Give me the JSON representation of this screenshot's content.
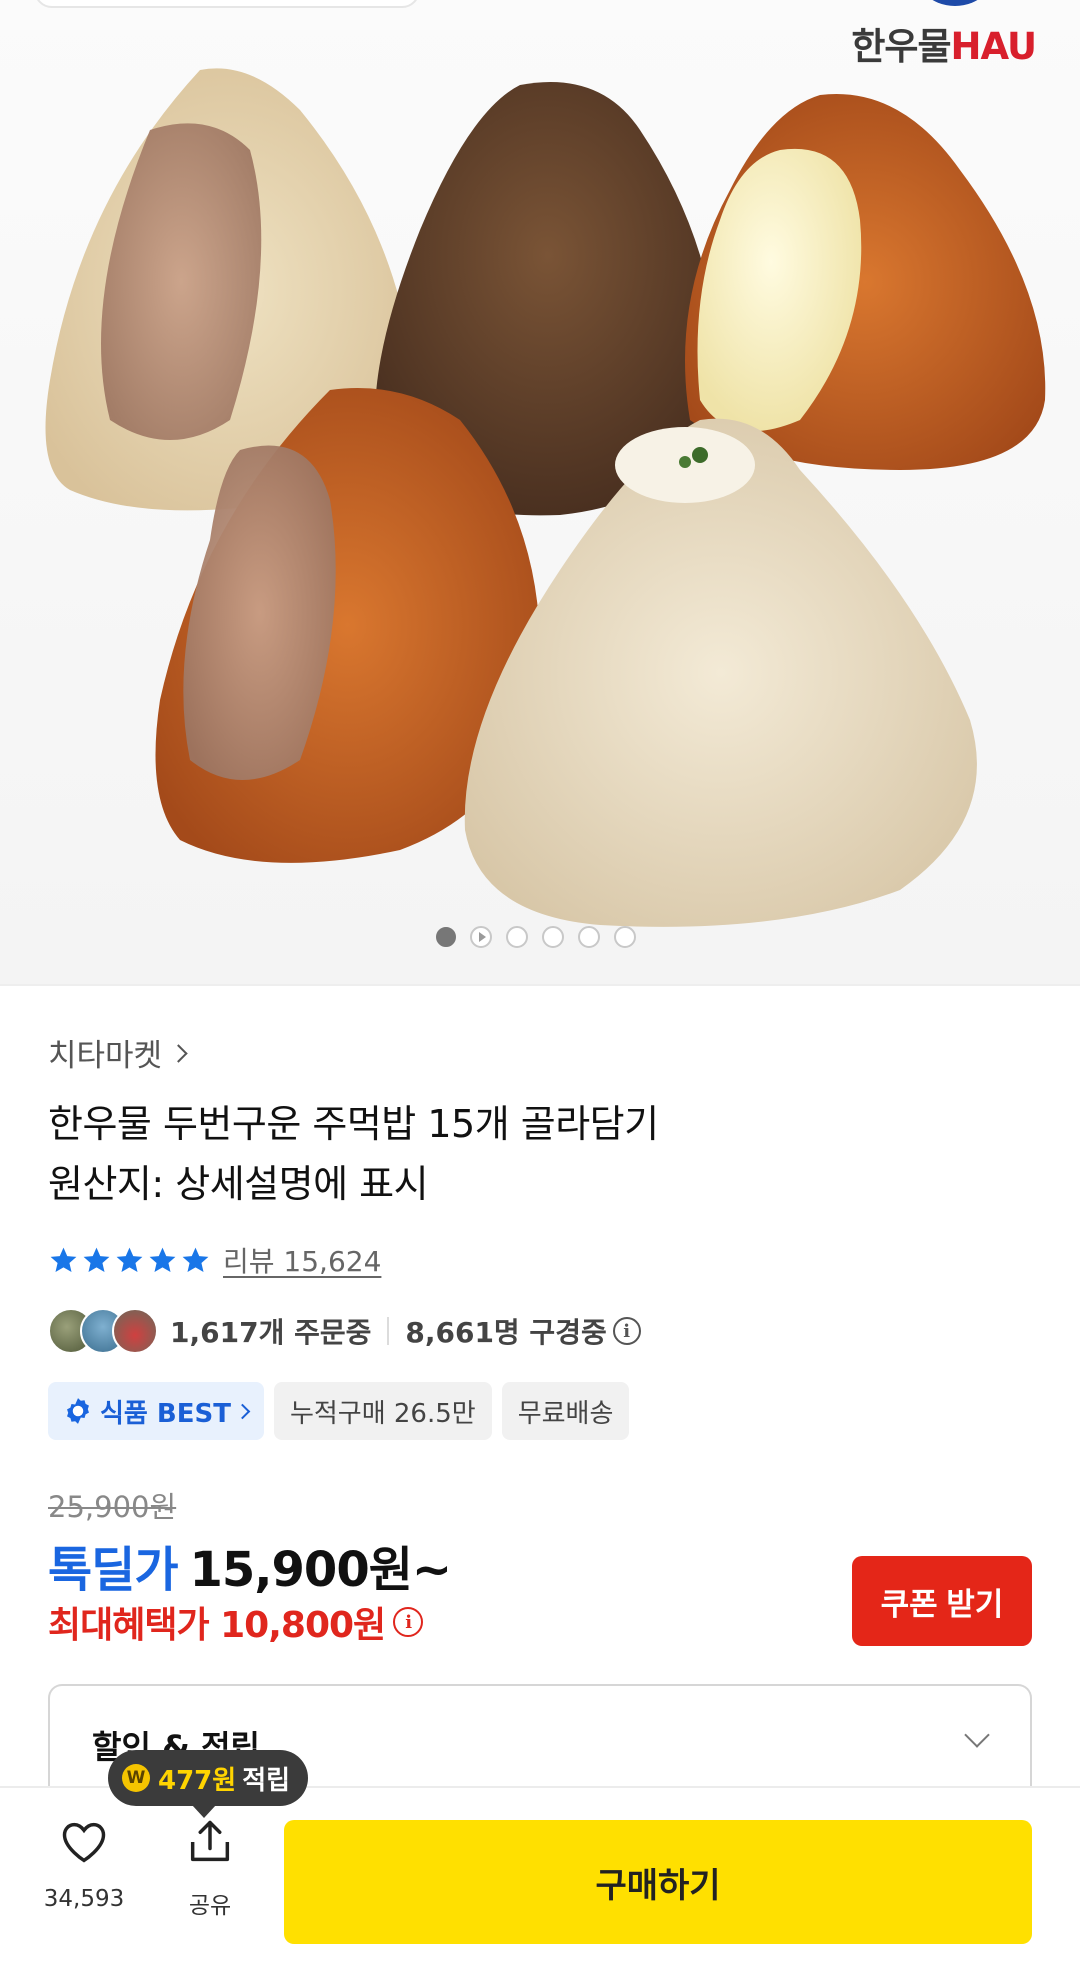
{
  "hero": {
    "brand_ko": "한우물",
    "brand_en": "HAU",
    "carousel_total": 6,
    "carousel_active": 1
  },
  "product": {
    "seller": "치타마켓",
    "title_line1": "한우물 두번구운 주먹밥 15개 골라담기",
    "title_line2": "원산지: 상세설명에 표시",
    "rating_stars": 5,
    "review_label": "리뷰 15,624",
    "orders_text": "1,617개 주문중",
    "viewers_text": "8,661명 구경중",
    "tags": {
      "best": "식품 BEST",
      "cumulative": "누적구매 26.5만",
      "shipping": "무료배송"
    }
  },
  "price": {
    "original": "25,900원",
    "deal_label": "톡딜가",
    "deal_value": "15,900원~",
    "max_benefit": "최대혜택가 10,800원",
    "coupon_button": "쿠폰 받기"
  },
  "discount_section": {
    "title": "할인 & 적립"
  },
  "points_tooltip": {
    "coin": "W",
    "amount": "477원",
    "suffix": "적립"
  },
  "bottom_bar": {
    "like_count": "34,593",
    "share_label": "공유",
    "buy_label": "구매하기"
  },
  "colors": {
    "deal_blue": "#1a66e0",
    "benefit_red": "#e0261d",
    "coupon_red": "#e42618",
    "buy_yellow": "#ffe000",
    "star_blue": "#1976e8"
  }
}
